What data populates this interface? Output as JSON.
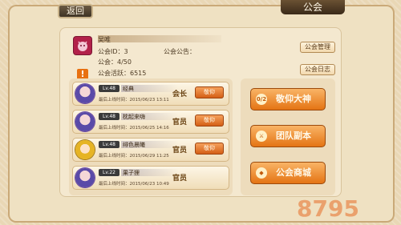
{
  "header": {
    "back_label": "返回",
    "title": "公会"
  },
  "guild": {
    "id_label": "公会ID：3",
    "members_label": "公会：4/50",
    "activity_label": "公会活跃：6515",
    "notice_label": "公会公告：",
    "name_prefix": "吴唯"
  },
  "side_buttons": {
    "manage": "公会管理",
    "log": "公会日志"
  },
  "members": [
    {
      "level": "Lv.48",
      "name": "经典",
      "last_login": "最后上线时间：2015/06/23 13:11",
      "rank": "会长",
      "action": "敬仰",
      "hair": "purple"
    },
    {
      "level": "Lv.48",
      "name": "枕起来嗨",
      "last_login": "最后上线时间：2015/06/25 14:16",
      "rank": "官员",
      "action": "敬仰",
      "hair": "purple"
    },
    {
      "level": "Lv.48",
      "name": "绯色晨曦",
      "last_login": "最后上线时间：2015/06/29 11:25",
      "rank": "官员",
      "action": "敬仰",
      "hair": "blonde"
    },
    {
      "level": "Lv.22",
      "name": "果子狸",
      "last_login": "最后上线时间：2015/06/23 10:49",
      "rank": "官员",
      "action": "",
      "hair": "purple"
    }
  ],
  "actions": {
    "worship": "敬仰大神",
    "raid": "团队副本",
    "shop": "公会商城",
    "worship_badge": "0/2"
  },
  "watermark": "8795"
}
